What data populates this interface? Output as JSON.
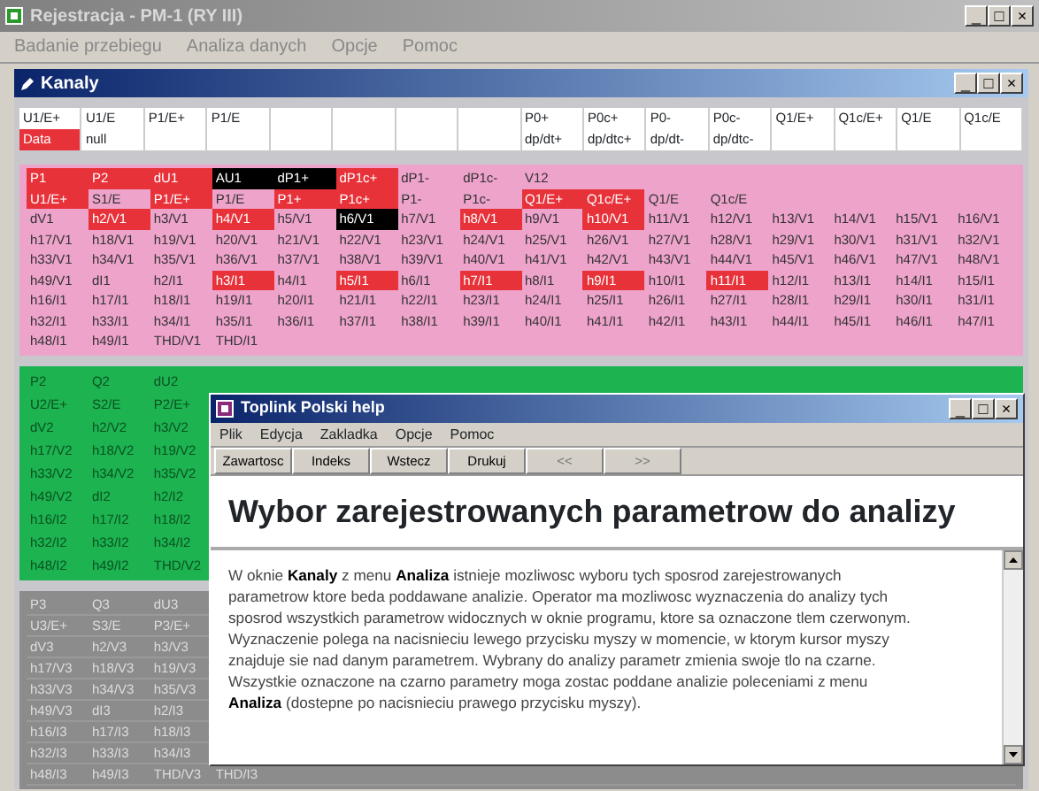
{
  "window": {
    "title": "Rejestracja - PM-1 (RY III)",
    "controls": [
      "_",
      "□",
      "×"
    ]
  },
  "menu": [
    "Badanie przebiegu",
    "Analiza danych",
    "Opcje",
    "Pomoc"
  ],
  "channels_window": {
    "title": "Kanaly",
    "controls": [
      "_",
      "□",
      "×"
    ],
    "header_left": [
      {
        "label": "U1/E+",
        "value": "Data",
        "selected": true
      },
      {
        "label": "U1/E",
        "value": "null",
        "selected": false
      },
      {
        "label": "P1/E+"
      },
      {
        "label": "P1/E"
      }
    ],
    "header_right": [
      {
        "label": "P0+",
        "value": "dp/dt+",
        "selected": false
      },
      {
        "label": "P0c+",
        "value": "dp/dtc+",
        "selected": false
      },
      {
        "label": "P0-",
        "value": "dp/dt-",
        "selected": false
      },
      {
        "label": "P0c-",
        "value": "dp/dtc-",
        "selected": false
      },
      {
        "label": "Q1/E+"
      },
      {
        "label": "Q1c/E+"
      },
      {
        "label": "Q1/E"
      },
      {
        "label": "Q1c/E"
      }
    ],
    "panels": [
      {
        "color": "#eea3cb",
        "rows": [
          [
            {
              "label": "P1",
              "selected": true,
              "analysed": false
            },
            {
              "label": "P2",
              "selected": true,
              "analysed": false
            },
            {
              "label": "dU1",
              "selected": true,
              "analysed": false
            },
            {
              "label": "AU1",
              "selected": false,
              "analysed": true
            },
            {
              "label": "dP1+",
              "selected": false,
              "analysed": true
            },
            {
              "label": "dP1c+",
              "selected": true,
              "analysed": false
            },
            {
              "label": "dP1-",
              "selected": false,
              "analysed": false
            },
            {
              "label": "dP1c-",
              "selected": false,
              "analysed": false
            },
            {
              "label": "V12",
              "selected": false,
              "analysed": false
            }
          ],
          [
            {
              "label": "U1/E+",
              "selected": true,
              "analysed": false
            },
            {
              "label": "S1/E",
              "selected": false,
              "analysed": false
            },
            {
              "label": "P1/E+",
              "selected": true,
              "analysed": false
            },
            {
              "label": "P1/E",
              "selected": false,
              "analysed": false
            },
            {
              "label": "P1+",
              "selected": true,
              "analysed": false
            },
            {
              "label": "P1c+",
              "selected": true,
              "analysed": false
            },
            {
              "label": "P1-",
              "selected": false,
              "analysed": false
            },
            {
              "label": "P1c-",
              "selected": false,
              "analysed": false
            },
            {
              "label": "Q1/E+",
              "selected": true,
              "analysed": false
            },
            {
              "label": "Q1c/E+",
              "selected": true,
              "analysed": false
            },
            {
              "label": "Q1/E",
              "selected": false,
              "analysed": false
            },
            {
              "label": "Q1c/E",
              "selected": false,
              "analysed": false
            }
          ],
          [
            {
              "label": "dV1",
              "selected": false,
              "analysed": false
            },
            {
              "label": "h2/V1",
              "selected": true,
              "analysed": false
            },
            {
              "label": "h3/V1",
              "selected": false,
              "analysed": false
            },
            {
              "label": "h4/V1",
              "selected": true,
              "analysed": false
            },
            {
              "label": "h5/V1",
              "selected": false,
              "analysed": false
            },
            {
              "label": "h6/V1",
              "selected": false,
              "analysed": true
            },
            {
              "label": "h7/V1",
              "selected": false,
              "analysed": false
            },
            {
              "label": "h8/V1",
              "selected": true,
              "analysed": false
            },
            {
              "label": "h9/V1",
              "selected": false,
              "analysed": false
            },
            {
              "label": "h10/V1",
              "selected": true,
              "analysed": false
            },
            {
              "label": "h11/V1",
              "selected": false,
              "analysed": false
            },
            {
              "label": "h12/V1",
              "selected": false,
              "analysed": false
            },
            {
              "label": "h13/V1",
              "selected": false,
              "analysed": false
            },
            {
              "label": "h14/V1",
              "selected": false,
              "analysed": false
            },
            {
              "label": "h15/V1",
              "selected": false,
              "analysed": false
            },
            {
              "label": "h16/V1",
              "selected": false,
              "analysed": false
            }
          ],
          [
            {
              "label": "h17/V1",
              "selected": false,
              "analysed": false
            },
            {
              "label": "h18/V1",
              "selected": false,
              "analysed": false
            },
            {
              "label": "h19/V1",
              "selected": false,
              "analysed": false
            },
            {
              "label": "h20/V1",
              "selected": false,
              "analysed": false
            },
            {
              "label": "h21/V1",
              "selected": false,
              "analysed": false
            },
            {
              "label": "h22/V1",
              "selected": false,
              "analysed": false
            },
            {
              "label": "h23/V1",
              "selected": false,
              "analysed": false
            },
            {
              "label": "h24/V1",
              "selected": false,
              "analysed": false
            },
            {
              "label": "h25/V1",
              "selected": false,
              "analysed": false
            },
            {
              "label": "h26/V1",
              "selected": false,
              "analysed": false
            },
            {
              "label": "h27/V1",
              "selected": false,
              "analysed": false
            },
            {
              "label": "h28/V1",
              "selected": false,
              "analysed": false
            },
            {
              "label": "h29/V1",
              "selected": false,
              "analysed": false
            },
            {
              "label": "h30/V1",
              "selected": false,
              "analysed": false
            },
            {
              "label": "h31/V1",
              "selected": false,
              "analysed": false
            },
            {
              "label": "h32/V1",
              "selected": false,
              "analysed": false
            }
          ],
          [
            {
              "label": "h33/V1",
              "selected": false,
              "analysed": false
            },
            {
              "label": "h34/V1",
              "selected": false,
              "analysed": false
            },
            {
              "label": "h35/V1",
              "selected": false,
              "analysed": false
            },
            {
              "label": "h36/V1",
              "selected": false,
              "analysed": false
            },
            {
              "label": "h37/V1",
              "selected": false,
              "analysed": false
            },
            {
              "label": "h38/V1",
              "selected": false,
              "analysed": false
            },
            {
              "label": "h39/V1",
              "selected": false,
              "analysed": false
            },
            {
              "label": "h40/V1",
              "selected": false,
              "analysed": false
            },
            {
              "label": "h41/V1",
              "selected": false,
              "analysed": false
            },
            {
              "label": "h42/V1",
              "selected": false,
              "analysed": false
            },
            {
              "label": "h43/V1",
              "selected": false,
              "analysed": false
            },
            {
              "label": "h44/V1",
              "selected": false,
              "analysed": false
            },
            {
              "label": "h45/V1",
              "selected": false,
              "analysed": false
            },
            {
              "label": "h46/V1",
              "selected": false,
              "analysed": false
            },
            {
              "label": "h47/V1",
              "selected": false,
              "analysed": false
            },
            {
              "label": "h48/V1",
              "selected": false,
              "analysed": false
            }
          ],
          [
            {
              "label": "h49/V1",
              "selected": false,
              "analysed": false
            },
            {
              "label": "dI1",
              "selected": false,
              "analysed": false
            },
            {
              "label": "h2/I1",
              "selected": false,
              "analysed": false
            },
            {
              "label": "h3/I1",
              "selected": true,
              "analysed": false
            },
            {
              "label": "h4/I1",
              "selected": false,
              "analysed": false
            },
            {
              "label": "h5/I1",
              "selected": true,
              "analysed": false
            },
            {
              "label": "h6/I1",
              "selected": false,
              "analysed": false
            },
            {
              "label": "h7/I1",
              "selected": true,
              "analysed": false
            },
            {
              "label": "h8/I1",
              "selected": false,
              "analysed": false
            },
            {
              "label": "h9/I1",
              "selected": true,
              "analysed": false
            },
            {
              "label": "h10/I1",
              "selected": false,
              "analysed": false
            },
            {
              "label": "h11/I1",
              "selected": true,
              "analysed": false
            },
            {
              "label": "h12/I1",
              "selected": false,
              "analysed": false
            },
            {
              "label": "h13/I1",
              "selected": false,
              "analysed": false
            },
            {
              "label": "h14/I1",
              "selected": false,
              "analysed": false
            },
            {
              "label": "h15/I1",
              "selected": false,
              "analysed": false
            }
          ],
          [
            {
              "label": "h16/I1",
              "selected": false,
              "analysed": false
            },
            {
              "label": "h17/I1",
              "selected": false,
              "analysed": false
            },
            {
              "label": "h18/I1",
              "selected": false,
              "analysed": false
            },
            {
              "label": "h19/I1",
              "selected": false,
              "analysed": false
            },
            {
              "label": "h20/I1",
              "selected": false,
              "analysed": false
            },
            {
              "label": "h21/I1",
              "selected": false,
              "analysed": false
            },
            {
              "label": "h22/I1",
              "selected": false,
              "analysed": false
            },
            {
              "label": "h23/I1",
              "selected": false,
              "analysed": false
            },
            {
              "label": "h24/I1",
              "selected": false,
              "analysed": false
            },
            {
              "label": "h25/I1",
              "selected": false,
              "analysed": false
            },
            {
              "label": "h26/I1",
              "selected": false,
              "analysed": false
            },
            {
              "label": "h27/I1",
              "selected": false,
              "analysed": false
            },
            {
              "label": "h28/I1",
              "selected": false,
              "analysed": false
            },
            {
              "label": "h29/I1",
              "selected": false,
              "analysed": false
            },
            {
              "label": "h30/I1",
              "selected": false,
              "analysed": false
            },
            {
              "label": "h31/I1",
              "selected": false,
              "analysed": false
            }
          ],
          [
            {
              "label": "h32/I1",
              "selected": false,
              "analysed": false
            },
            {
              "label": "h33/I1",
              "selected": false,
              "analysed": false
            },
            {
              "label": "h34/I1",
              "selected": false,
              "analysed": false
            },
            {
              "label": "h35/I1",
              "selected": false,
              "analysed": false
            },
            {
              "label": "h36/I1",
              "selected": false,
              "analysed": false
            },
            {
              "label": "h37/I1",
              "selected": false,
              "analysed": false
            },
            {
              "label": "h38/I1",
              "selected": false,
              "analysed": false
            },
            {
              "label": "h39/I1",
              "selected": false,
              "analysed": false
            },
            {
              "label": "h40/I1",
              "selected": false,
              "analysed": false
            },
            {
              "label": "h41/I1",
              "selected": false,
              "analysed": false
            },
            {
              "label": "h42/I1",
              "selected": false,
              "analysed": false
            },
            {
              "label": "h43/I1",
              "selected": false,
              "analysed": false
            },
            {
              "label": "h44/I1",
              "selected": false,
              "analysed": false
            },
            {
              "label": "h45/I1",
              "selected": false,
              "analysed": false
            },
            {
              "label": "h46/I1",
              "selected": false,
              "analysed": false
            },
            {
              "label": "h47/I1",
              "selected": false,
              "analysed": false
            }
          ],
          [
            {
              "label": "h48/I1",
              "selected": false,
              "analysed": false
            },
            {
              "label": "h49/I1",
              "selected": false,
              "analysed": false
            },
            {
              "label": "THD/V1",
              "selected": false,
              "analysed": false
            },
            {
              "label": "THD/I1",
              "selected": false,
              "analysed": false
            }
          ]
        ]
      },
      {
        "color": "#1cb350",
        "rows": [
          [
            "P2",
            "Q2",
            "dU2"
          ],
          [
            "U2/E+",
            "S2/E",
            "P2/E+"
          ],
          [
            "dV2",
            "h2/V2",
            "h3/V2"
          ],
          [
            "h17/V2",
            "h18/V2",
            "h19/V2"
          ],
          [
            "h33/V2",
            "h34/V2",
            "h35/V2"
          ],
          [
            "h49/V2",
            "dI2",
            "h2/I2"
          ],
          [
            "h16/I2",
            "h17/I2",
            "h18/I2"
          ],
          [
            "h32/I2",
            "h33/I2",
            "h34/I2"
          ],
          [
            "h48/I2",
            "h49/I2",
            "THD/V2"
          ]
        ]
      },
      {
        "color": "#8c8c8c",
        "rows": [
          [
            "P3",
            "Q3",
            "dU3"
          ],
          [
            "U3/E+",
            "S3/E",
            "P3/E+"
          ],
          [
            "dV3",
            "h2/V3",
            "h3/V3"
          ],
          [
            "h17/V3",
            "h18/V3",
            "h19/V3"
          ],
          [
            "h33/V3",
            "h34/V3",
            "h35/V3"
          ],
          [
            "h49/V3",
            "dI3",
            "h2/I3"
          ],
          [
            "h16/I3",
            "h17/I3",
            "h18/I3"
          ],
          [
            "h32/I3",
            "h33/I3",
            "h34/I3"
          ],
          [
            "h48/I3",
            "h49/I3",
            "THD/V3",
            "THD/I3"
          ]
        ]
      }
    ]
  },
  "help_window": {
    "title": "Toplink Polski help",
    "controls": [
      "_",
      "□",
      "×"
    ],
    "menu": [
      "Plik",
      "Edycja",
      "Zakladka",
      "Opcje",
      "Pomoc"
    ],
    "buttons": [
      {
        "label": "Zawartosc",
        "disabled": false
      },
      {
        "label": "Indeks",
        "disabled": false
      },
      {
        "label": "Wstecz",
        "disabled": false
      },
      {
        "label": "Drukuj",
        "disabled": false
      },
      {
        "label": "<<",
        "disabled": true
      },
      {
        "label": ">>",
        "disabled": true
      }
    ],
    "heading": "Wybor zarejestrowanych parametrow do analizy",
    "body": "W oknie **Kanaly** z menu **Analiza** istnieje mozliwosc wyboru tych sposrod zarejestrowanych parametrow ktore beda poddawane analizie. Operator ma mozliwosc wyznaczenia do analizy tych sposrod wszystkich parametrow widocznych w oknie programu, ktore sa oznaczone tlem czerwonym. Wyznaczenie polega na nacisnieciu lewego przycisku myszy w momencie, w ktorym kursor myszy znajduje sie nad danym parametrem. Wybrany do analizy parametr zmienia swoje tlo na czarne. Wszystkie oznaczone na czarno parametry moga zostac poddane analizie poleceniami z menu **Analiza** (dostepne po nacisnieciu prawego przycisku myszy)."
  }
}
